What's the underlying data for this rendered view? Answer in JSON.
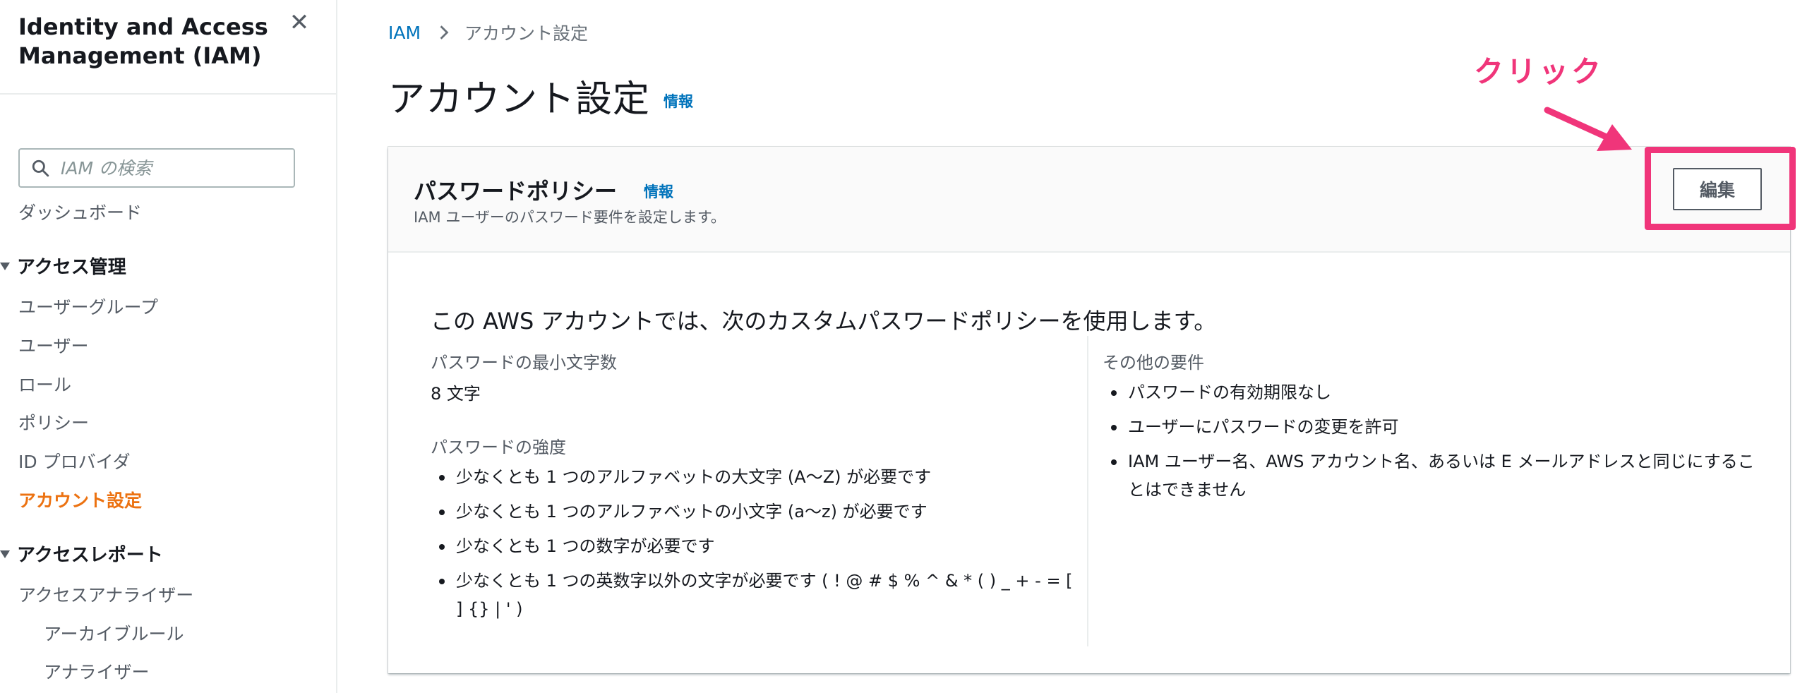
{
  "sidebar": {
    "title": "Identity and Access Management (IAM)",
    "search_placeholder": "IAM の検索",
    "dashboard": "ダッシュボード",
    "access_mgmt": {
      "label": "アクセス管理",
      "items": [
        "ユーザーグループ",
        "ユーザー",
        "ロール",
        "ポリシー",
        "ID プロバイダ",
        "アカウント設定"
      ]
    },
    "access_reports": {
      "label": "アクセスレポート",
      "items": [
        "アクセスアナライザー",
        "アーカイブルール",
        "アナライザー"
      ]
    },
    "active_item": "アカウント設定",
    "active_color": "#ec7211"
  },
  "breadcrumb": {
    "root": "IAM",
    "current": "アカウント設定"
  },
  "page": {
    "title": "アカウント設定",
    "info": "情報"
  },
  "panel": {
    "title": "パスワードポリシー",
    "info": "情報",
    "description": "IAM ユーザーのパスワード要件を設定します。",
    "edit_label": "編集",
    "intro": "この AWS アカウントでは、次のカスタムパスワードポリシーを使用します。",
    "min_length_label": "パスワードの最小文字数",
    "min_length_value": "8 文字",
    "strength_label": "パスワードの強度",
    "strength_items": [
      "少なくとも 1 つのアルファベットの大文字 (A〜Z) が必要です",
      "少なくとも 1 つのアルファベットの小文字 (a〜z) が必要です",
      "少なくとも 1 つの数字が必要です",
      "少なくとも 1 つの英数字以外の文字が必要です ( ! @ # $ % ^ & * ( ) _ + - = [ ] {} | ' )"
    ],
    "other_label": "その他の要件",
    "other_items": [
      "パスワードの有効期限なし",
      "ユーザーにパスワードの変更を許可",
      "IAM ユーザー名、AWS アカウント名、あるいは E メールアドレスと同じにすることはできません"
    ]
  },
  "annotation": {
    "label": "クリック",
    "color": "#f0357a"
  }
}
